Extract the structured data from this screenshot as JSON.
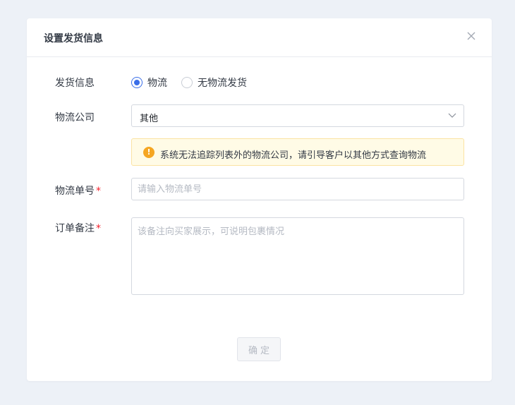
{
  "dialog": {
    "title": "设置发货信息",
    "close_icon": "close-icon"
  },
  "form": {
    "ship_info": {
      "label": "发货信息",
      "options": [
        {
          "label": "物流",
          "checked": true
        },
        {
          "label": "无物流发货",
          "checked": false
        }
      ]
    },
    "company": {
      "label": "物流公司",
      "value": "其他",
      "arrow_icon": "chevron-down-icon"
    },
    "alert": {
      "icon": "warning-icon",
      "text": "系统无法追踪列表外的物流公司，请引导客户以其他方式查询物流",
      "color": "#f5a623"
    },
    "tracking": {
      "label": "物流单号",
      "required_mark": "*",
      "placeholder": "请输入物流单号",
      "value": ""
    },
    "remark": {
      "label": "订单备注",
      "required_mark": "*",
      "placeholder": "该备注向买家展示，可说明包裹情况",
      "value": ""
    }
  },
  "footer": {
    "confirm_label": "确定",
    "confirm_disabled": true
  },
  "colors": {
    "accent": "#3a6ee8",
    "required": "#f5222d",
    "page_bg": "#edf1f7"
  }
}
